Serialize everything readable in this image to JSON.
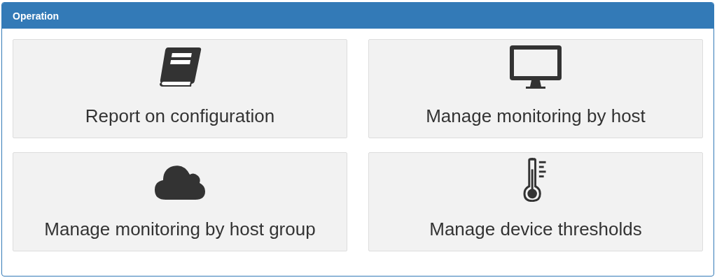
{
  "panel": {
    "title": "Operation"
  },
  "tiles": [
    {
      "label": "Report on configuration",
      "kind": "book"
    },
    {
      "label": "Manage monitoring by host",
      "kind": "monitor"
    },
    {
      "label": "Manage monitoring by host group",
      "kind": "cloud"
    },
    {
      "label": "Manage device thresholds",
      "kind": "thermometer"
    }
  ]
}
